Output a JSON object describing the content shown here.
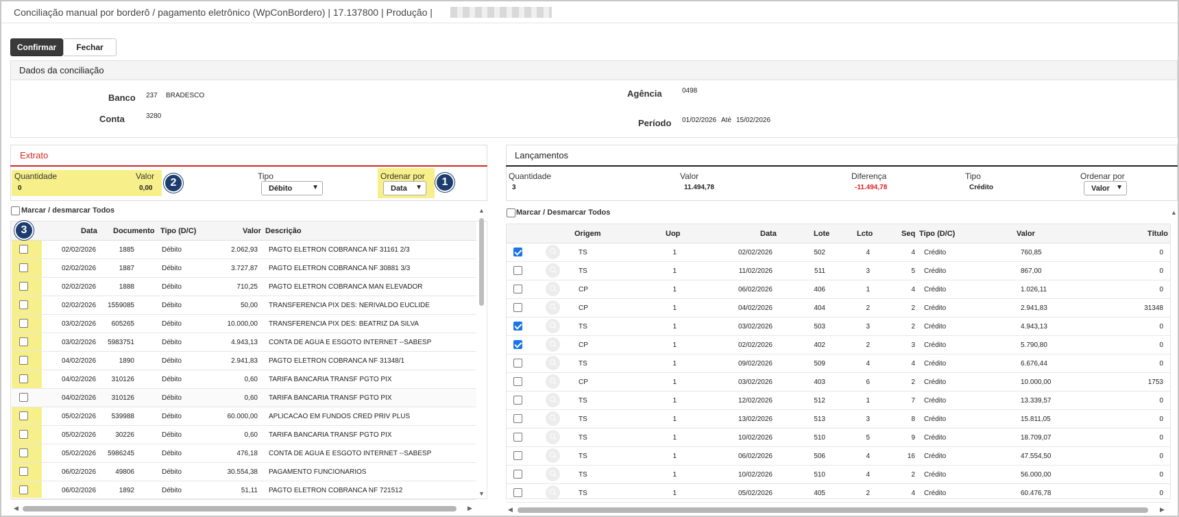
{
  "window": {
    "title": "Conciliação manual por borderô / pagamento eletrônico (WpConBordero) | 17.137800 | Produção |"
  },
  "toolbar": {
    "confirm_label": "Confirmar",
    "close_label": "Fechar"
  },
  "dados": {
    "header": "Dados da conciliação",
    "banco_label": "Banco",
    "banco_codigo": "237",
    "banco_nome": "BRADESCO",
    "conta_label": "Conta",
    "conta_valor": "3280",
    "agencia_label": "Agência",
    "agencia_valor": "0498",
    "periodo_label": "Período",
    "periodo_inicio": "01/02/2026",
    "ate_label": "Até",
    "periodo_fim": "15/02/2026"
  },
  "extrato": {
    "title": "Extrato",
    "quantidade_label": "Quantidade",
    "quantidade_valor": "0",
    "valor_label": "Valor",
    "valor_valor": "0,00",
    "tipo_label": "Tipo",
    "tipo_selected": "Débito",
    "ordenar_label": "Ordenar por",
    "ordenar_selected": "Data",
    "mark_all_label": "Marcar / desmarcar Todos",
    "columns": {
      "data": "Data",
      "documento": "Documento",
      "tipo": "Tipo (D/C)",
      "valor": "Valor",
      "descricao": "Descrição"
    },
    "rows": [
      {
        "data": "02/02/2026",
        "documento": "1885",
        "tipo": "Débito",
        "valor": "2.062,93",
        "descricao": "PAGTO ELETRON COBRANCA NF 31161 2/3"
      },
      {
        "data": "02/02/2026",
        "documento": "1887",
        "tipo": "Débito",
        "valor": "3.727,87",
        "descricao": "PAGTO ELETRON COBRANCA NF 30881 3/3"
      },
      {
        "data": "02/02/2026",
        "documento": "1888",
        "tipo": "Débito",
        "valor": "710,25",
        "descricao": "PAGTO ELETRON COBRANCA MAN ELEVADOR"
      },
      {
        "data": "02/02/2026",
        "documento": "1559085",
        "tipo": "Débito",
        "valor": "50,00",
        "descricao": "TRANSFERENCIA PIX DES: NERIVALDO EUCLIDE"
      },
      {
        "data": "03/02/2026",
        "documento": "605265",
        "tipo": "Débito",
        "valor": "10.000,00",
        "descricao": "TRANSFERENCIA PIX DES: BEATRIZ DA SILVA"
      },
      {
        "data": "03/02/2026",
        "documento": "5983751",
        "tipo": "Débito",
        "valor": "4.943,13",
        "descricao": "CONTA DE AGUA E ESGOTO INTERNET --SABESP"
      },
      {
        "data": "04/02/2026",
        "documento": "1890",
        "tipo": "Débito",
        "valor": "2.941,83",
        "descricao": "PAGTO ELETRON COBRANCA NF 31348/1"
      },
      {
        "data": "04/02/2026",
        "documento": "310126",
        "tipo": "Débito",
        "valor": "0,60",
        "descricao": "TARIFA BANCARIA TRANSF PGTO PIX"
      },
      {
        "data": "04/02/2026",
        "documento": "310126",
        "tipo": "Débito",
        "valor": "0,60",
        "descricao": "TARIFA BANCARIA TRANSF PGTO PIX"
      },
      {
        "data": "05/02/2026",
        "documento": "539988",
        "tipo": "Débito",
        "valor": "60.000,00",
        "descricao": "APLICACAO EM FUNDOS CRED PRIV PLUS"
      },
      {
        "data": "05/02/2026",
        "documento": "30226",
        "tipo": "Débito",
        "valor": "0,60",
        "descricao": "TARIFA BANCARIA TRANSF PGTO PIX"
      },
      {
        "data": "05/02/2026",
        "documento": "5986245",
        "tipo": "Débito",
        "valor": "476,18",
        "descricao": "CONTA DE AGUA E ESGOTO INTERNET --SABESP"
      },
      {
        "data": "06/02/2026",
        "documento": "49806",
        "tipo": "Débito",
        "valor": "30.554,38",
        "descricao": "PAGAMENTO FUNCIONARIOS"
      },
      {
        "data": "06/02/2026",
        "documento": "1892",
        "tipo": "Débito",
        "valor": "51,11",
        "descricao": "PAGTO ELETRON COBRANCA NF 721512"
      }
    ]
  },
  "lancamentos": {
    "title": "Lançamentos",
    "quantidade_label": "Quantidade",
    "quantidade_valor": "3",
    "valor_label": "Valor",
    "valor_valor": "11.494,78",
    "diferenca_label": "Diferença",
    "diferenca_valor": "-11.494,78",
    "tipo_label": "Tipo",
    "tipo_valor": "Crédito",
    "ordenar_label": "Ordenar por",
    "ordenar_selected": "Valor",
    "mark_all_label": "Marcar / Desmarcar Todos",
    "columns": {
      "origem": "Origem",
      "uop": "Uop",
      "data": "Data",
      "lote": "Lote",
      "lcto": "Lcto",
      "seq": "Seq",
      "tipo": "Tipo (D/C)",
      "valor": "Valor",
      "titulo": "Título"
    },
    "rows": [
      {
        "checked": true,
        "origem": "TS",
        "uop": "1",
        "data": "02/02/2026",
        "lote": "502",
        "lcto": "4",
        "seq": "4",
        "tipo": "Crédito",
        "valor": "760,85",
        "titulo": "0"
      },
      {
        "checked": false,
        "origem": "TS",
        "uop": "1",
        "data": "11/02/2026",
        "lote": "511",
        "lcto": "3",
        "seq": "5",
        "tipo": "Crédito",
        "valor": "867,00",
        "titulo": "0"
      },
      {
        "checked": false,
        "origem": "CP",
        "uop": "1",
        "data": "06/02/2026",
        "lote": "406",
        "lcto": "1",
        "seq": "4",
        "tipo": "Crédito",
        "valor": "1.026,11",
        "titulo": "0"
      },
      {
        "checked": false,
        "origem": "CP",
        "uop": "1",
        "data": "04/02/2026",
        "lote": "404",
        "lcto": "2",
        "seq": "2",
        "tipo": "Crédito",
        "valor": "2.941,83",
        "titulo": "31348"
      },
      {
        "checked": true,
        "origem": "TS",
        "uop": "1",
        "data": "03/02/2026",
        "lote": "503",
        "lcto": "3",
        "seq": "2",
        "tipo": "Crédito",
        "valor": "4.943,13",
        "titulo": "0"
      },
      {
        "checked": true,
        "origem": "CP",
        "uop": "1",
        "data": "02/02/2026",
        "lote": "402",
        "lcto": "2",
        "seq": "3",
        "tipo": "Crédito",
        "valor": "5.790,80",
        "titulo": "0"
      },
      {
        "checked": false,
        "origem": "TS",
        "uop": "1",
        "data": "09/02/2026",
        "lote": "509",
        "lcto": "4",
        "seq": "4",
        "tipo": "Crédito",
        "valor": "6.676,44",
        "titulo": "0"
      },
      {
        "checked": false,
        "origem": "CP",
        "uop": "1",
        "data": "03/02/2026",
        "lote": "403",
        "lcto": "6",
        "seq": "2",
        "tipo": "Crédito",
        "valor": "10.000,00",
        "titulo": "1753"
      },
      {
        "checked": false,
        "origem": "TS",
        "uop": "1",
        "data": "12/02/2026",
        "lote": "512",
        "lcto": "1",
        "seq": "7",
        "tipo": "Crédito",
        "valor": "13.339,57",
        "titulo": "0"
      },
      {
        "checked": false,
        "origem": "TS",
        "uop": "1",
        "data": "13/02/2026",
        "lote": "513",
        "lcto": "3",
        "seq": "8",
        "tipo": "Crédito",
        "valor": "15.811,05",
        "titulo": "0"
      },
      {
        "checked": false,
        "origem": "TS",
        "uop": "1",
        "data": "10/02/2026",
        "lote": "510",
        "lcto": "5",
        "seq": "9",
        "tipo": "Crédito",
        "valor": "18.709,07",
        "titulo": "0"
      },
      {
        "checked": false,
        "origem": "TS",
        "uop": "1",
        "data": "06/02/2026",
        "lote": "506",
        "lcto": "4",
        "seq": "16",
        "tipo": "Crédito",
        "valor": "47.554,50",
        "titulo": "0"
      },
      {
        "checked": false,
        "origem": "TS",
        "uop": "1",
        "data": "10/02/2026",
        "lote": "510",
        "lcto": "4",
        "seq": "2",
        "tipo": "Crédito",
        "valor": "56.000,00",
        "titulo": "0"
      },
      {
        "checked": false,
        "origem": "TS",
        "uop": "1",
        "data": "05/02/2026",
        "lote": "405",
        "lcto": "2",
        "seq": "4",
        "tipo": "Crédito",
        "valor": "60.476,78",
        "titulo": "0"
      }
    ]
  },
  "annotations": {
    "badge1": "1",
    "badge2": "2",
    "badge3": "3"
  },
  "colors": {
    "extrato_accent": "#d0281f",
    "lancamentos_accent": "#222222",
    "highlight": "#f7f08a",
    "badge": "#1c3d6e",
    "checkbox_checked": "#1a73e8",
    "diferenca": "#e02020"
  }
}
